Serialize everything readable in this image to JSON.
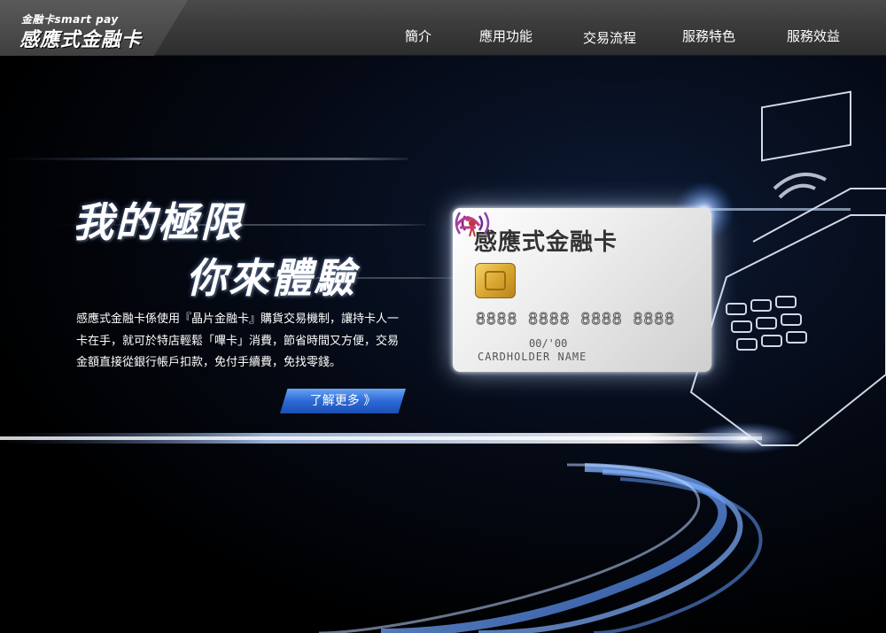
{
  "header": {
    "logo_small": "金融卡smart pay",
    "logo_big": "感應式金融卡",
    "nav": [
      {
        "label": "簡介"
      },
      {
        "label": "應用功能"
      },
      {
        "label": "交易流程"
      },
      {
        "label": "服務特色"
      },
      {
        "label": "服務效益"
      }
    ]
  },
  "hero": {
    "headline_line1": "我的極限",
    "headline_line2": "你來體驗",
    "description": "感應式金融卡係使用『晶片金融卡』購貨交易機制，讓持卡人一卡在手，就可於特店輕鬆「嗶卡」消費，節省時間又方便，交易金額直接從銀行帳戶扣款，免付手續費，免找零錢。",
    "learn_more_label": "了解更多 》"
  },
  "card": {
    "title": "感應式金融卡",
    "number": "8888 8888 8888 8888",
    "expiry": "00/'00",
    "holder": "CARDHOLDER NAME"
  },
  "colors": {
    "accent_blue": "#2d6ad6",
    "header_bg": "#3a3a3a",
    "light_streak": "#cfe3ff"
  }
}
